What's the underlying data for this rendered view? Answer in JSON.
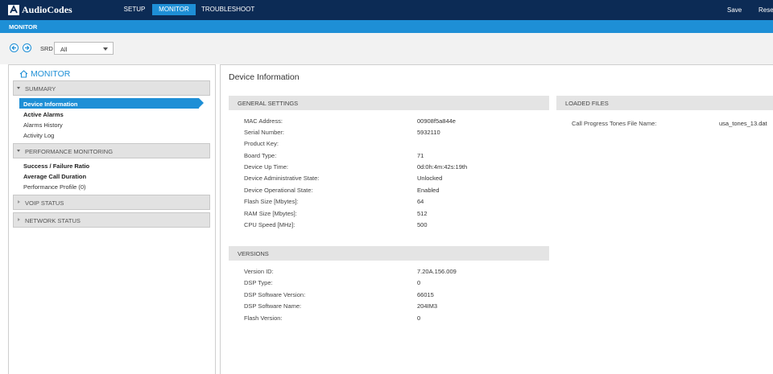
{
  "app": {
    "brand": "AudioCodes",
    "nav_tabs": [
      {
        "label": "SETUP"
      },
      {
        "label": "MONITOR"
      },
      {
        "label": "TROUBLESHOOT"
      }
    ],
    "save_label": "Save",
    "reset_label": "Reset",
    "subheader": "MONITOR"
  },
  "colors": {
    "navbar": "#0c2b55",
    "accent": "#1e8fd6",
    "section_bg": "#e4e4e4"
  },
  "toolbar": {
    "srd_label": "SRD",
    "srd_value": "All"
  },
  "sidebar": {
    "title": "MONITOR",
    "groups": [
      {
        "label": "SUMMARY",
        "expanded": true
      },
      {
        "label": "PERFORMANCE MONITORING",
        "expanded": true
      },
      {
        "label": "VOIP STATUS",
        "expanded": false
      },
      {
        "label": "NETWORK STATUS",
        "expanded": false
      }
    ],
    "summary_items": [
      {
        "label": "Device Information",
        "selected": true
      },
      {
        "label": "Active Alarms"
      },
      {
        "label": "Alarms History"
      },
      {
        "label": "Activity Log"
      }
    ],
    "performance_items": [
      {
        "label": "Success / Failure Ratio"
      },
      {
        "label": "Average Call Duration"
      },
      {
        "label": "Performance Profile (0)"
      }
    ]
  },
  "main": {
    "title": "Device Information",
    "general": {
      "header": "GENERAL SETTINGS",
      "rows": [
        {
          "label": "MAC Address:",
          "value": "00908f5a844e"
        },
        {
          "label": "Serial Number:",
          "value": "5932110"
        },
        {
          "label": "Product Key:",
          "value": ""
        },
        {
          "label": "Board Type:",
          "value": "71"
        },
        {
          "label": "Device Up Time:",
          "value": "0d:0h:4m:42s:19th"
        },
        {
          "label": "Device Administrative State:",
          "value": "Unlocked"
        },
        {
          "label": "Device Operational State:",
          "value": "Enabled"
        },
        {
          "label": "Flash Size [Mbytes]:",
          "value": "64"
        },
        {
          "label": "RAM Size [Mbytes]:",
          "value": "512"
        },
        {
          "label": "CPU Speed [MHz]:",
          "value": "500"
        }
      ]
    },
    "versions": {
      "header": "VERSIONS",
      "rows": [
        {
          "label": "Version ID:",
          "value": "7.20A.156.009"
        },
        {
          "label": "DSP Type:",
          "value": "0"
        },
        {
          "label": "DSP Software Version:",
          "value": "66015"
        },
        {
          "label": "DSP Software Name:",
          "value": "204IM3"
        },
        {
          "label": "Flash Version:",
          "value": "0"
        }
      ]
    },
    "loaded_files": {
      "header": "LOADED FILES",
      "rows": [
        {
          "label": "Call Progress Tones File Name:",
          "value": "usa_tones_13.dat"
        }
      ]
    }
  }
}
